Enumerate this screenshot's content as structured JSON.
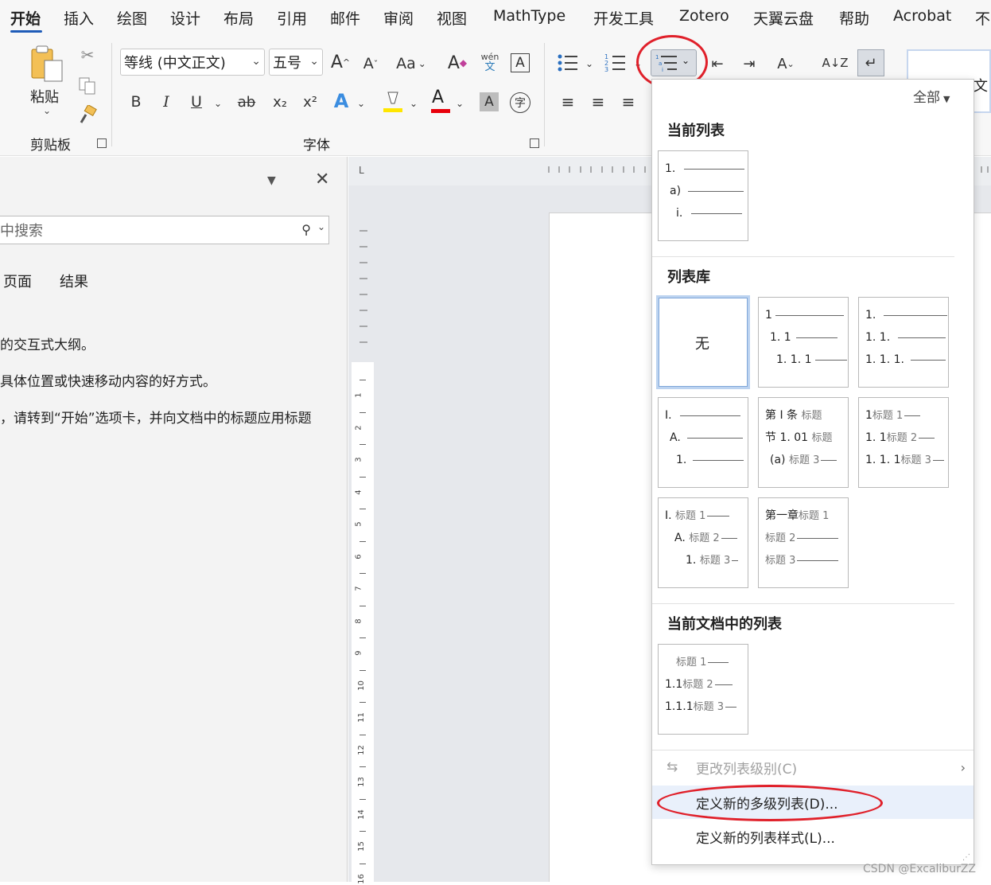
{
  "tabs": [
    "开始",
    "插入",
    "绘图",
    "设计",
    "布局",
    "引用",
    "邮件",
    "审阅",
    "视图",
    "MathType",
    "开发工具",
    "Zotero",
    "天翼云盘",
    "帮助",
    "Acrobat",
    "不"
  ],
  "ribbon": {
    "paste_label": "粘贴",
    "clipboard_group": "剪贴板",
    "font_name": "等线 (中文正文)",
    "font_size": "五号",
    "font_group": "字体",
    "change_case": "Aa",
    "phonetic_top": "wén",
    "phonetic_bottom": "文",
    "char_border": "A",
    "bold": "B",
    "italic": "I",
    "underline": "U",
    "strike": "ab",
    "subscript": "x₂",
    "superscript": "x²",
    "enclose_char": "字",
    "styles_preview": "文"
  },
  "nav": {
    "search_placeholder": "中搜索",
    "tab_pages": "页面",
    "tab_results": "结果",
    "line1": "的交互式大纲。",
    "line2": "具体位置或快速移动内容的好方式。",
    "line3": "，请转到“开始”选项卡，并向文档中的标题应用标题"
  },
  "vruler_numbers": [
    "1",
    "2",
    "3",
    "4",
    "5",
    "6",
    "7",
    "8",
    "9",
    "10",
    "11",
    "12",
    "13",
    "14",
    "15",
    "16"
  ],
  "dropdown": {
    "filter": "全部",
    "current_list_title": "当前列表",
    "current_list": [
      "1.",
      "a)",
      "i."
    ],
    "library_title": "列表库",
    "none_label": "无",
    "lib1": [
      "1",
      "1. 1",
      "1. 1. 1"
    ],
    "lib2": [
      "1.",
      "1. 1.",
      "1. 1. 1."
    ],
    "lib3": [
      "I.",
      "A.",
      "1."
    ],
    "lib4": [
      "第 I 条",
      "标题",
      "节 1. 01",
      "标题",
      "(a)",
      "标题 3"
    ],
    "lib5": [
      "1",
      "标题 1",
      "1. 1",
      "标题 2",
      "1. 1. 1",
      "标题 3"
    ],
    "lib6": [
      "I.",
      "标题 1",
      "A.",
      "标题 2",
      "1.",
      "标题 3"
    ],
    "lib7": [
      "第一章",
      "标题 1",
      "标题 2",
      "标题 3"
    ],
    "doc_lists_title": "当前文档中的列表",
    "doc_list": [
      "标题 1",
      "1.1",
      "标题 2",
      "1.1.1",
      "标题 3"
    ],
    "change_level": "更改列表级别(C)",
    "define_multilevel": "定义新的多级列表(D)...",
    "define_style": "定义新的列表样式(L)..."
  },
  "watermark": "CSDN @ExcaliburZZ",
  "colors": {
    "accent": "#1f5cb8",
    "highlight_ellipse": "#e0202a",
    "hover_bg": "#e9f0fb",
    "font_color_bar": "#e8000b",
    "highlight_bar": "#ffe600"
  }
}
